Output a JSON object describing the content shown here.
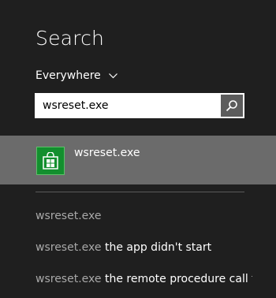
{
  "search_pane": {
    "title": "Search",
    "scope_label": "Everywhere",
    "query": "wsreset.exe"
  },
  "top_result": {
    "name": "wsreset.exe",
    "icon": "store-icon",
    "tile_color": "#138f2e"
  },
  "suggestions": [
    {
      "match": "wsreset.exe",
      "rest": ""
    },
    {
      "match": "wsreset.exe",
      "rest": " the app didn't start"
    },
    {
      "match": "wsreset.exe",
      "rest": " the remote procedure call fa..."
    }
  ],
  "colors": {
    "background": "#1f1f1f",
    "selected_result": "#6b6b6b",
    "suggestion_query_text": "#a8a8a8"
  }
}
